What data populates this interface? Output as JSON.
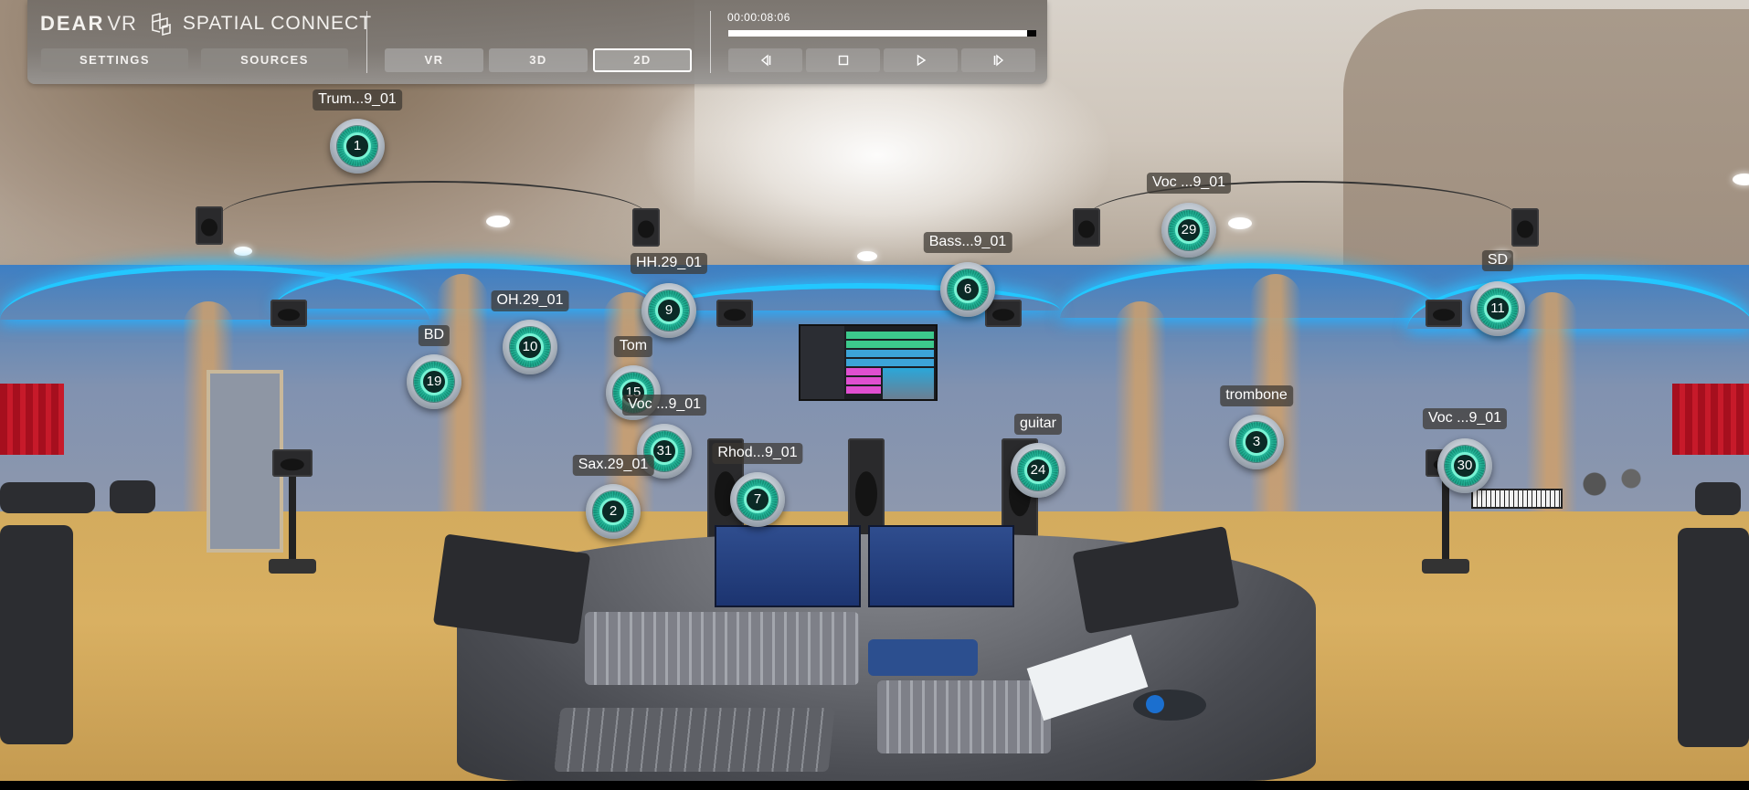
{
  "app": {
    "brand_primary": "DEAR",
    "brand_secondary": "VR",
    "product_name": "SPATIAL CONNECT"
  },
  "panel": {
    "buttons": {
      "settings": "SETTINGS",
      "sources": "SOURCES"
    },
    "view_modes": [
      {
        "label": "VR",
        "active": false
      },
      {
        "label": "3D",
        "active": false
      },
      {
        "label": "2D",
        "active": true
      }
    ],
    "transport": {
      "timecode": "00:00:08:06",
      "progress_percent": 97,
      "controls": [
        {
          "name": "skip-back",
          "icon": "skip-to-start-icon"
        },
        {
          "name": "stop",
          "icon": "stop-icon"
        },
        {
          "name": "play",
          "icon": "play-icon"
        },
        {
          "name": "skip-forward",
          "icon": "skip-to-end-icon"
        }
      ]
    }
  },
  "sources": [
    {
      "id": "1",
      "label": "Trum...9_01"
    },
    {
      "id": "29",
      "label": "Voc ...9_01"
    },
    {
      "id": "9",
      "label": "HH.29_01"
    },
    {
      "id": "6",
      "label": "Bass...9_01"
    },
    {
      "id": "11",
      "label": "SD"
    },
    {
      "id": "10",
      "label": "OH.29_01"
    },
    {
      "id": "19",
      "label": "BD"
    },
    {
      "id": "15",
      "label": "Tom"
    },
    {
      "id": "31",
      "label": "Voc ...9_01"
    },
    {
      "id": "3",
      "label": "trombone"
    },
    {
      "id": "24",
      "label": "guitar"
    },
    {
      "id": "30",
      "label": "Voc ...9_01"
    },
    {
      "id": "7",
      "label": "Rhod...9_01"
    },
    {
      "id": "2",
      "label": "Sax.29_01"
    }
  ],
  "colors": {
    "accent_teal": "#1faa8e",
    "led_blue": "#23c7ff",
    "panel_bg": "#7a7570"
  }
}
